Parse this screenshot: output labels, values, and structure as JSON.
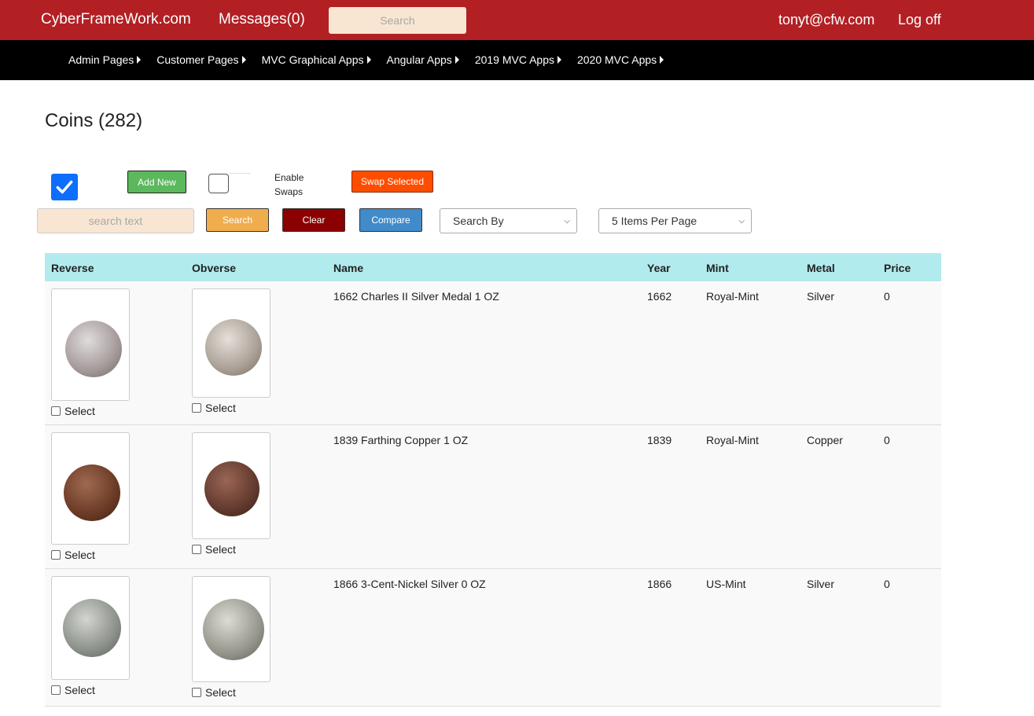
{
  "topbar": {
    "brand": "CyberFrameWork.com",
    "messages": "Messages(0)",
    "search_placeholder": "Search",
    "user": "tonyt@cfw.com",
    "logoff": "Log off"
  },
  "menu": {
    "items": [
      {
        "label": "Admin Pages"
      },
      {
        "label": "Customer Pages"
      },
      {
        "label": "MVC Graphical Apps"
      },
      {
        "label": "Angular Apps"
      },
      {
        "label": "2019 MVC Apps"
      },
      {
        "label": "2020 MVC Apps"
      }
    ]
  },
  "page": {
    "title": "Coins (282)"
  },
  "controls": {
    "add_new": "Add New",
    "enable_swaps": "Enable Swaps",
    "swap_selected": "Swap Selected",
    "search_placeholder": "search text",
    "search": "Search",
    "clear": "Clear",
    "compare": "Compare",
    "search_by": "Search By",
    "items_per_page": "5 Items Per Page"
  },
  "table": {
    "headers": {
      "reverse": "Reverse",
      "obverse": "Obverse",
      "name": "Name",
      "year": "Year",
      "mint": "Mint",
      "metal": "Metal",
      "price": "Price"
    },
    "select_label": "Select",
    "rows": [
      {
        "name": "1662 Charles II Silver Medal 1 OZ",
        "year": "1662",
        "mint": "Royal-Mint",
        "metal": "Silver",
        "price": "0"
      },
      {
        "name": "1839 Farthing Copper 1 OZ",
        "year": "1839",
        "mint": "Royal-Mint",
        "metal": "Copper",
        "price": "0"
      },
      {
        "name": "1866 3-Cent-Nickel Silver 0 OZ",
        "year": "1866",
        "mint": "US-Mint",
        "metal": "Silver",
        "price": "0"
      }
    ]
  },
  "colors": {
    "topbar": "#b22024",
    "menubar": "#000000",
    "header_row": "#b2ebee",
    "add_new": "#5cb85c",
    "swap_selected": "#ff4d00",
    "search": "#f0ad4e",
    "clear": "#8b0000",
    "compare": "#428bca"
  }
}
